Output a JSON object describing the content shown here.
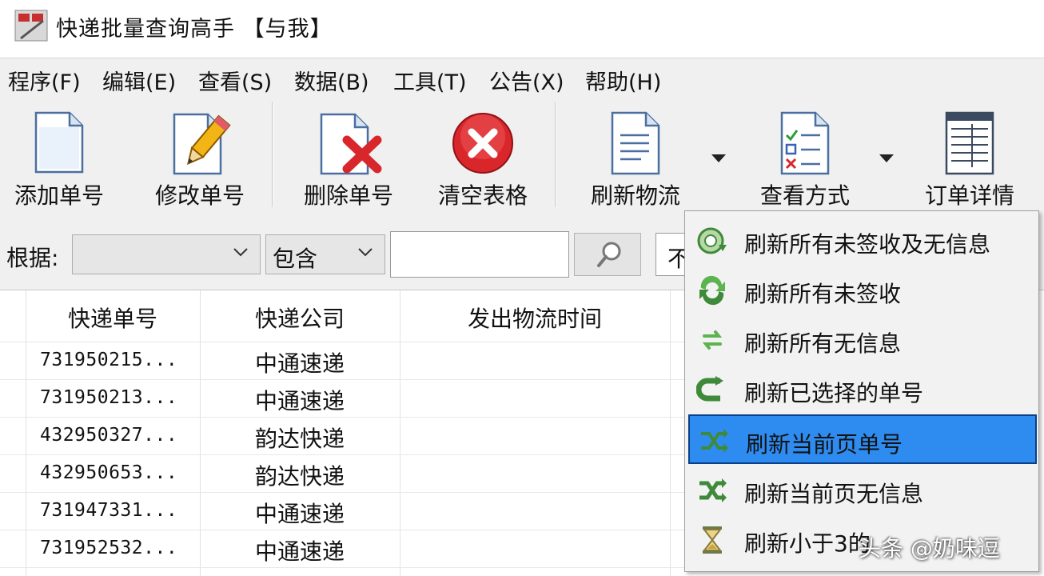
{
  "window": {
    "title": "快递批量查询高手 【与我】"
  },
  "menu": [
    {
      "label": "程序(F)"
    },
    {
      "label": "编辑(E)"
    },
    {
      "label": "查看(S)"
    },
    {
      "label": "数据(B)"
    },
    {
      "label": "工具(T)"
    },
    {
      "label": "公告(X)"
    },
    {
      "label": "帮助(H)"
    }
  ],
  "toolbar": {
    "add_label": "添加单号",
    "edit_label": "修改单号",
    "delete_label": "删除单号",
    "clear_label": "清空表格",
    "refresh_label": "刷新物流",
    "view_mode_label": "查看方式",
    "order_detail_label": "订单详情"
  },
  "filter": {
    "label": "根据:",
    "field_value": "",
    "match_value": "包含",
    "search_text": "",
    "extra_value": "不"
  },
  "table": {
    "columns": [
      "快递单号",
      "快递公司",
      "发出物流时间"
    ],
    "rows": [
      {
        "number": "731950215...",
        "company": "中通速递"
      },
      {
        "number": "731950213...",
        "company": "中通速递"
      },
      {
        "number": "432950327...",
        "company": "韵达快递"
      },
      {
        "number": "432950653...",
        "company": "韵达快递"
      },
      {
        "number": "731947331...",
        "company": "中通速递"
      },
      {
        "number": "731952532...",
        "company": "中通速递"
      }
    ]
  },
  "refresh_menu": {
    "items": [
      {
        "label": "刷新所有未签收及无信息",
        "icon": "refresh-all-icon"
      },
      {
        "label": "刷新所有未签收",
        "icon": "refresh-unsigned-icon"
      },
      {
        "label": "刷新所有无信息",
        "icon": "refresh-noinfo-icon"
      },
      {
        "label": "刷新已选择的单号",
        "icon": "refresh-selected-icon"
      },
      {
        "label": "刷新当前页单号",
        "icon": "refresh-page-icon"
      },
      {
        "label": "刷新当前页无信息",
        "icon": "refresh-page-noinfo-icon"
      },
      {
        "label": "刷新小于3的",
        "icon": "hourglass-icon"
      }
    ],
    "selected_index": 4
  },
  "watermark": "头条 @奶味逗",
  "colors": {
    "selection": "#2e8cf0",
    "chrome": "#f0f0f0",
    "delete_red": "#d9262b"
  }
}
